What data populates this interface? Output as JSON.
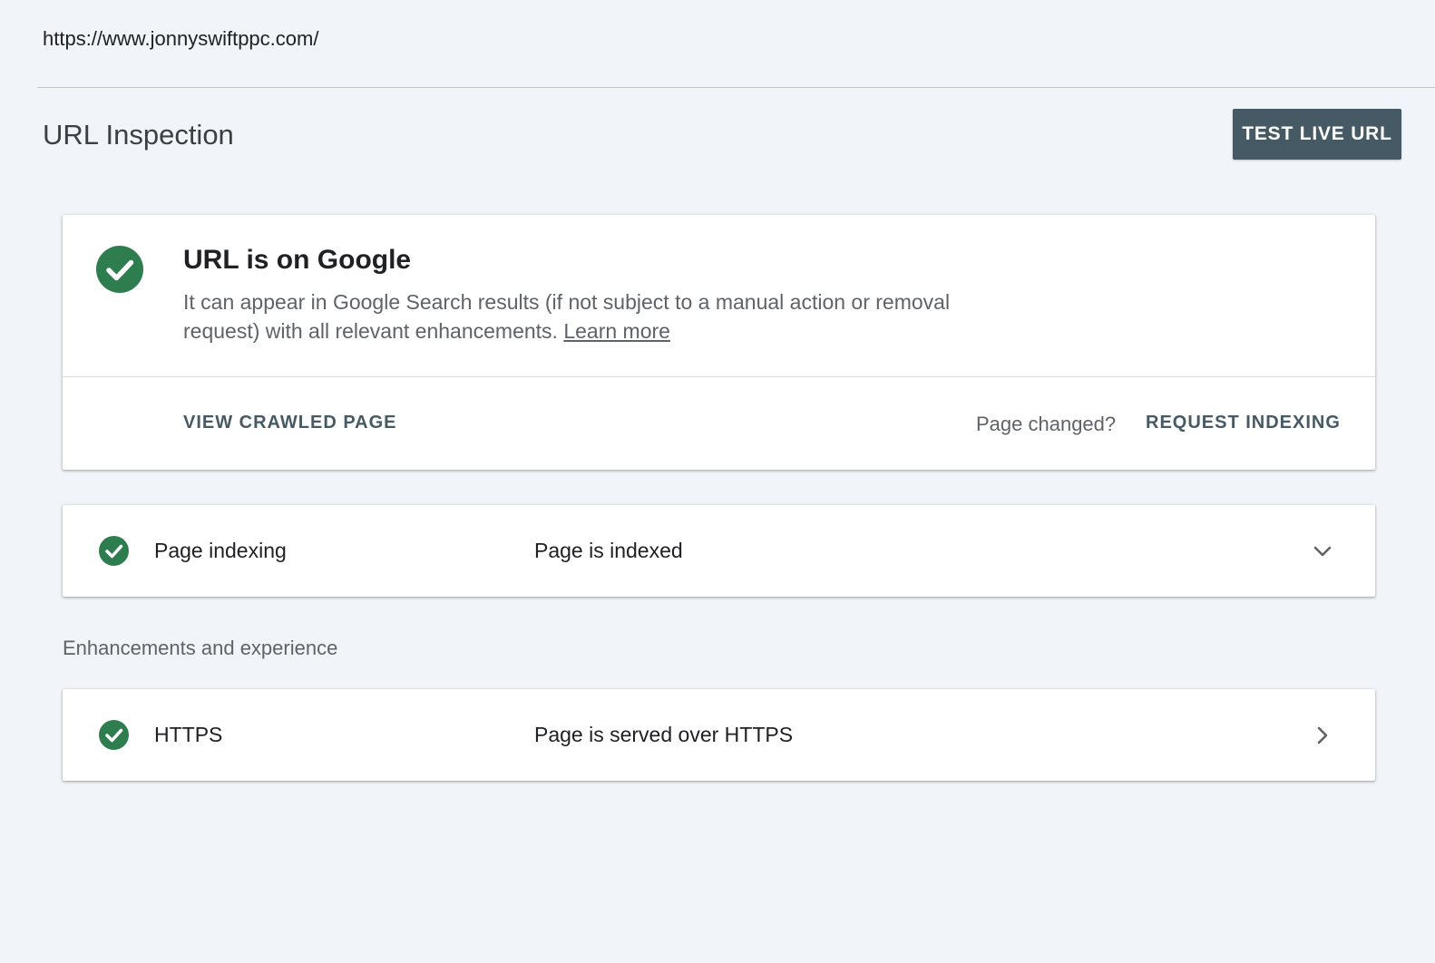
{
  "header": {
    "url": "https://www.jonnyswiftppc.com/"
  },
  "page": {
    "title": "URL Inspection",
    "test_live_label": "TEST LIVE URL"
  },
  "status_card": {
    "title": "URL is on Google",
    "description": "It can appear in Google Search results (if not subject to a manual action or removal request) with all relevant enhancements. ",
    "learn_more": "Learn more",
    "view_crawled_label": "VIEW CRAWLED PAGE",
    "page_changed_text": "Page changed?",
    "request_indexing_label": "REQUEST INDEXING",
    "icon": "check-circle-icon"
  },
  "rows": [
    {
      "label": "Page indexing",
      "value": "Page is indexed",
      "icon": "check-circle-icon",
      "chevron": "chevron-down-icon"
    },
    {
      "label": "HTTPS",
      "value": "Page is served over HTTPS",
      "icon": "check-circle-icon",
      "chevron": "chevron-right-icon"
    }
  ],
  "section": {
    "enhancements_label": "Enhancements and experience"
  },
  "colors": {
    "success": "#2e7d4f",
    "primary_button": "#455a64",
    "background": "#f1f4f8"
  }
}
